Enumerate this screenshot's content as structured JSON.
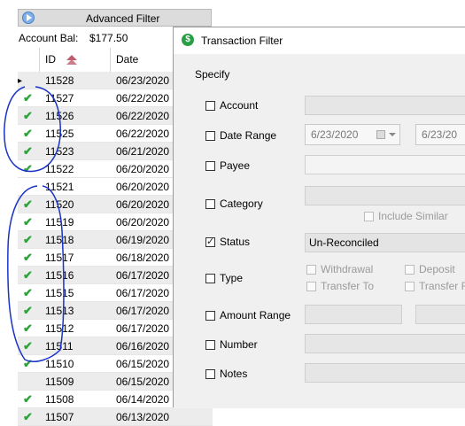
{
  "adv_filter": {
    "title": "Advanced Filter",
    "account_bal_label": "Account Bal:",
    "account_bal_value": "$177.50"
  },
  "grid": {
    "headers": {
      "id": "ID",
      "date": "Date"
    },
    "rows": [
      {
        "id": "11528",
        "date": "06/23/2020",
        "checked": false,
        "selected": true
      },
      {
        "id": "11527",
        "date": "06/22/2020",
        "checked": true,
        "selected": false
      },
      {
        "id": "11526",
        "date": "06/22/2020",
        "checked": true,
        "selected": true
      },
      {
        "id": "11525",
        "date": "06/22/2020",
        "checked": true,
        "selected": false
      },
      {
        "id": "11523",
        "date": "06/21/2020",
        "checked": true,
        "selected": true
      },
      {
        "id": "11522",
        "date": "06/20/2020",
        "checked": true,
        "selected": false
      },
      {
        "id": "11521",
        "date": "06/20/2020",
        "checked": false,
        "selected": false
      },
      {
        "id": "11520",
        "date": "06/20/2020",
        "checked": true,
        "selected": true
      },
      {
        "id": "11519",
        "date": "06/20/2020",
        "checked": true,
        "selected": false
      },
      {
        "id": "11518",
        "date": "06/19/2020",
        "checked": true,
        "selected": true
      },
      {
        "id": "11517",
        "date": "06/18/2020",
        "checked": true,
        "selected": false
      },
      {
        "id": "11516",
        "date": "06/17/2020",
        "checked": true,
        "selected": true
      },
      {
        "id": "11515",
        "date": "06/17/2020",
        "checked": true,
        "selected": false
      },
      {
        "id": "11513",
        "date": "06/17/2020",
        "checked": true,
        "selected": true
      },
      {
        "id": "11512",
        "date": "06/17/2020",
        "checked": true,
        "selected": false
      },
      {
        "id": "11511",
        "date": "06/16/2020",
        "checked": true,
        "selected": true
      },
      {
        "id": "11510",
        "date": "06/15/2020",
        "checked": true,
        "selected": false
      },
      {
        "id": "11509",
        "date": "06/15/2020",
        "checked": false,
        "selected": true
      },
      {
        "id": "11508",
        "date": "06/14/2020",
        "checked": true,
        "selected": false
      },
      {
        "id": "11507",
        "date": "06/13/2020",
        "checked": true,
        "selected": true
      }
    ]
  },
  "dialog": {
    "title": "Transaction Filter",
    "icon": "dollar-icon",
    "specify": "Specify",
    "account": "Account",
    "date_range": "Date Range",
    "date_from": "6/23/2020",
    "date_to": "6/23/20",
    "payee": "Payee",
    "category": "Category",
    "include_similar": "Include Similar",
    "status": "Status",
    "status_value": "Un-Reconciled",
    "type": "Type",
    "withdrawal": "Withdrawal",
    "deposit": "Deposit",
    "transfer_to": "Transfer To",
    "transfer_from": "Transfer Fr",
    "amount_range": "Amount Range",
    "number": "Number",
    "notes": "Notes"
  },
  "colors": {
    "check_green": "#2fa33b",
    "annotation_blue": "#1a33c9",
    "sort_icon": "#c05d6d"
  }
}
